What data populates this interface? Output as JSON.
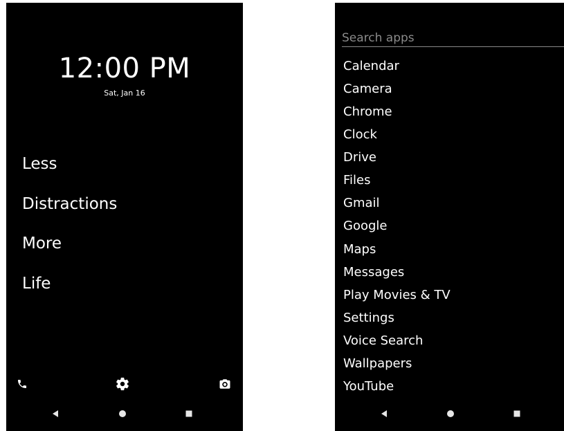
{
  "home": {
    "time": "12:00 PM",
    "date": "Sat, Jan 16",
    "favorites": [
      "Less",
      "Distractions",
      "More",
      "Life"
    ],
    "dock": {
      "left_icon": "phone-icon",
      "center_icon": "gear-icon",
      "right_icon": "camera-icon"
    }
  },
  "drawer": {
    "search_placeholder": "Search apps",
    "search_value": "",
    "apps": [
      "Calendar",
      "Camera",
      "Chrome",
      "Clock",
      "Drive",
      "Files",
      "Gmail",
      "Google",
      "Maps",
      "Messages",
      "Play Movies & TV",
      "Settings",
      "Voice Search",
      "Wallpapers",
      "YouTube"
    ]
  },
  "navbar": {
    "buttons": [
      "back-icon",
      "home-icon",
      "recents-icon"
    ]
  },
  "colors": {
    "background": "#000000",
    "text": "#ffffff",
    "muted": "#8a8a8a",
    "nav_icon": "#e6e6e6",
    "page_bg": "#ffffff"
  }
}
